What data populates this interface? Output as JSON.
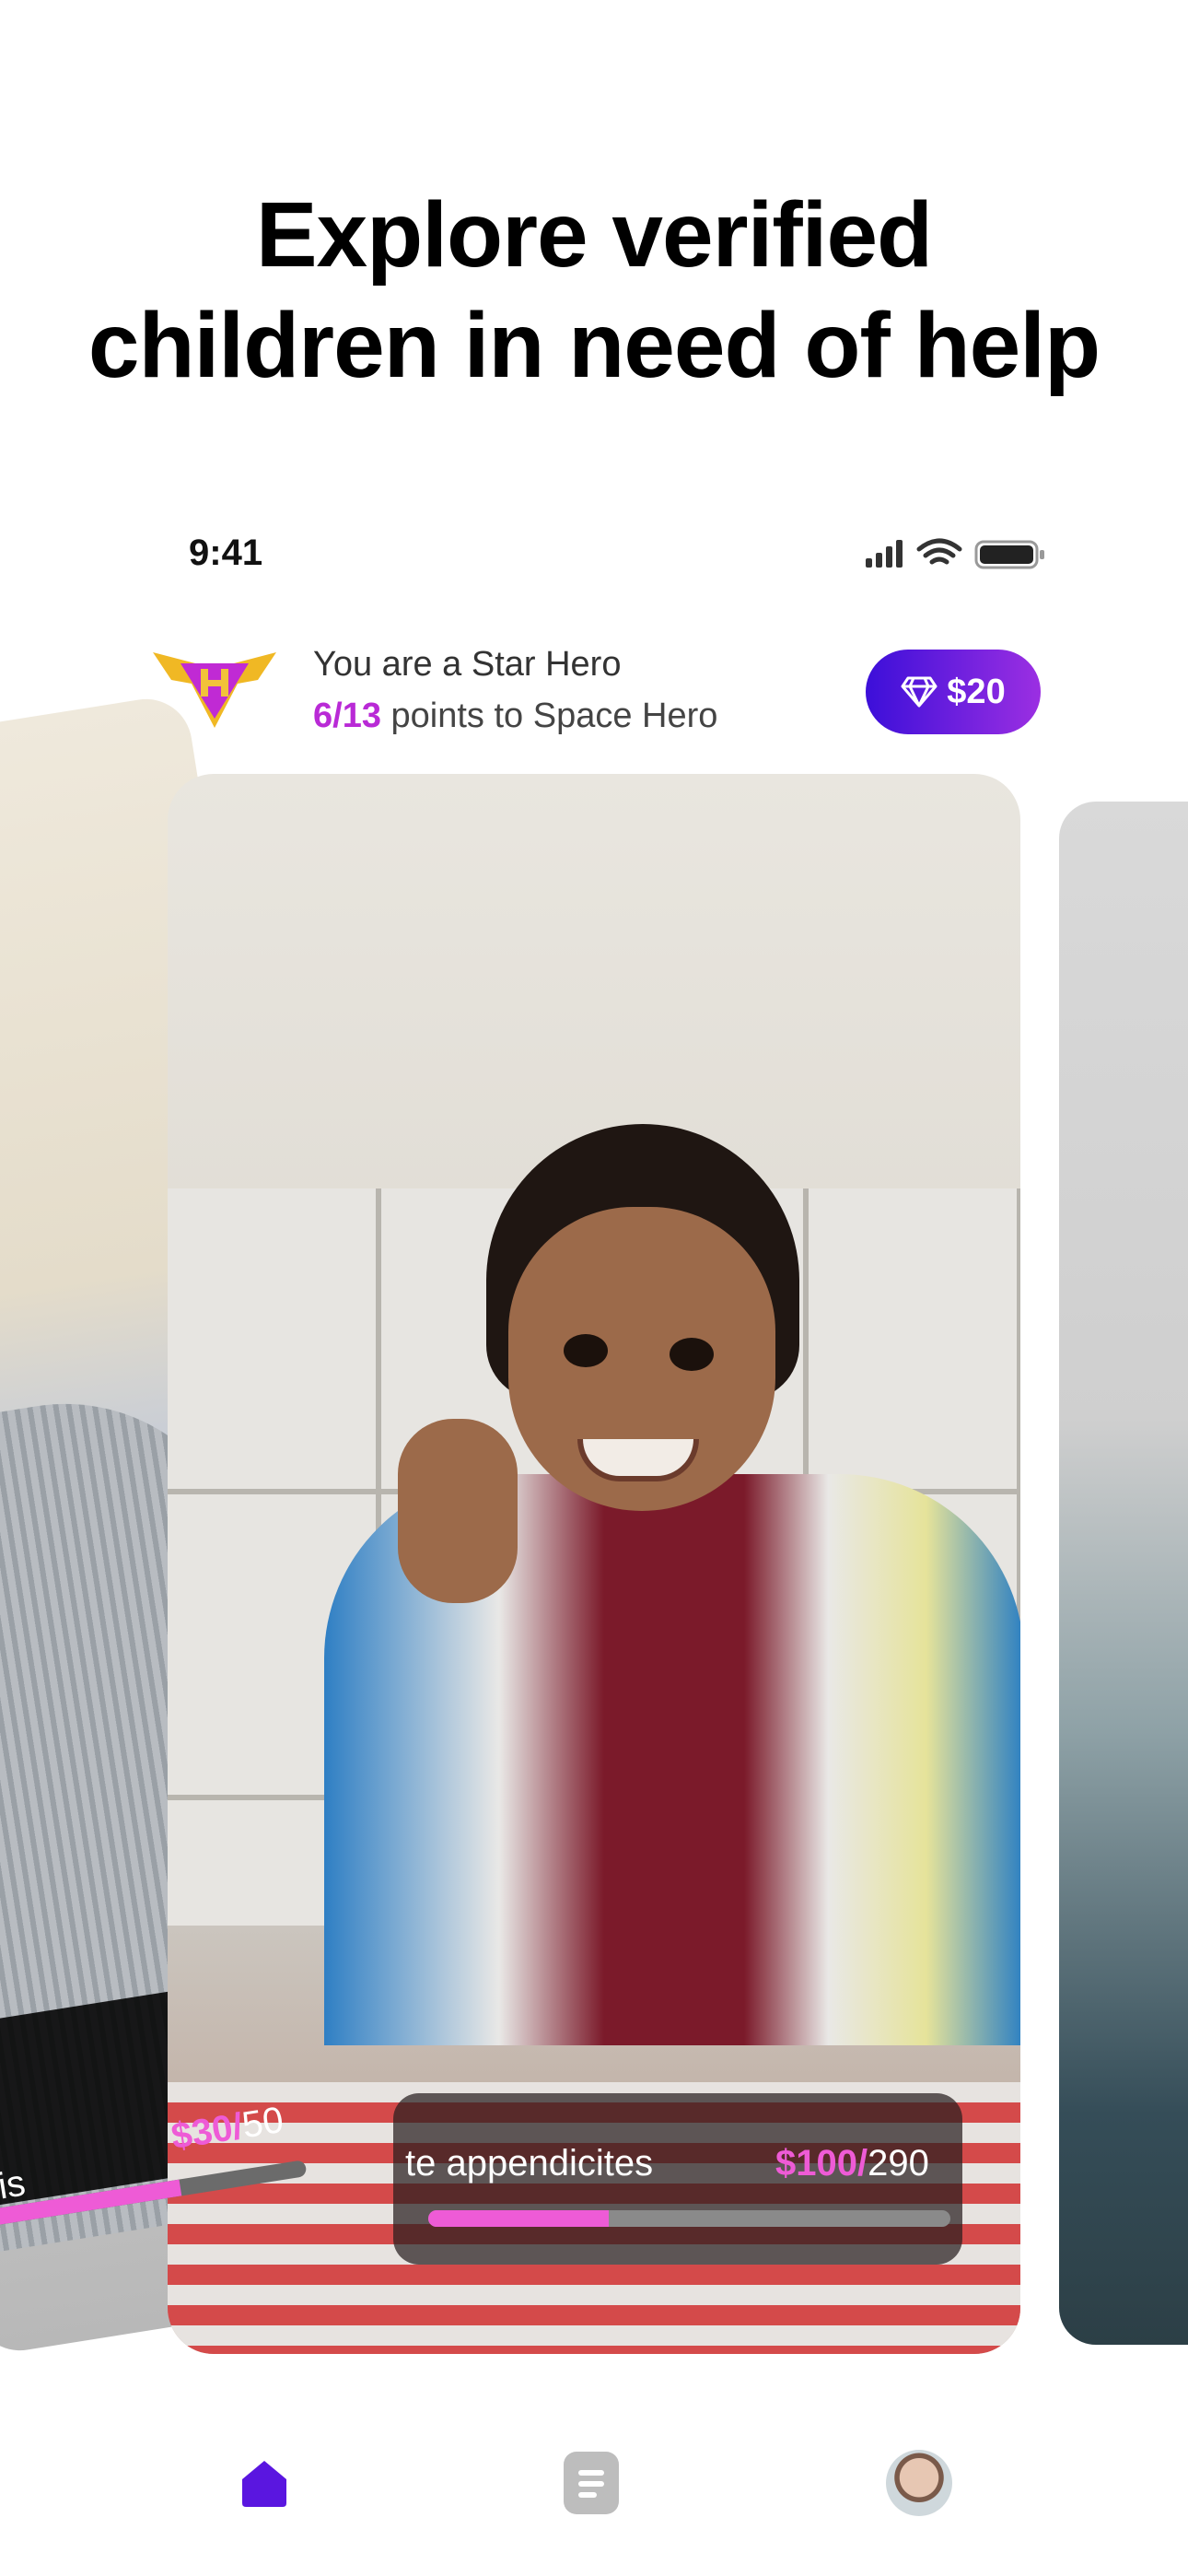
{
  "headline": {
    "line1": "Explore verified",
    "line2": "children in need of help"
  },
  "status_bar": {
    "time": "9:41"
  },
  "header": {
    "rank_text": "You are a Star Hero",
    "points_progress": "6/13",
    "points_suffix": " points to Space Hero",
    "wallet_amount": "$20"
  },
  "cards": {
    "left": {
      "name_fragment": "is",
      "raised": "$30/",
      "goal": "50",
      "progress_fraction": 0.6
    },
    "main": {
      "title_fragment": "te appendicites",
      "raised": "$100/",
      "goal": "290",
      "progress_fraction": 0.345
    }
  },
  "colors": {
    "accent_pink": "#ee5bd6",
    "wallet_gradient_start": "#3c0fd9",
    "wallet_gradient_end": "#9b2fe2",
    "nav_active": "#5a16e0",
    "nav_inactive": "#b9b9b9"
  },
  "nav": {
    "items": [
      {
        "icon": "home-icon",
        "active": true
      },
      {
        "icon": "document-list-icon",
        "active": false
      },
      {
        "icon": "profile-avatar",
        "active": false
      }
    ]
  }
}
